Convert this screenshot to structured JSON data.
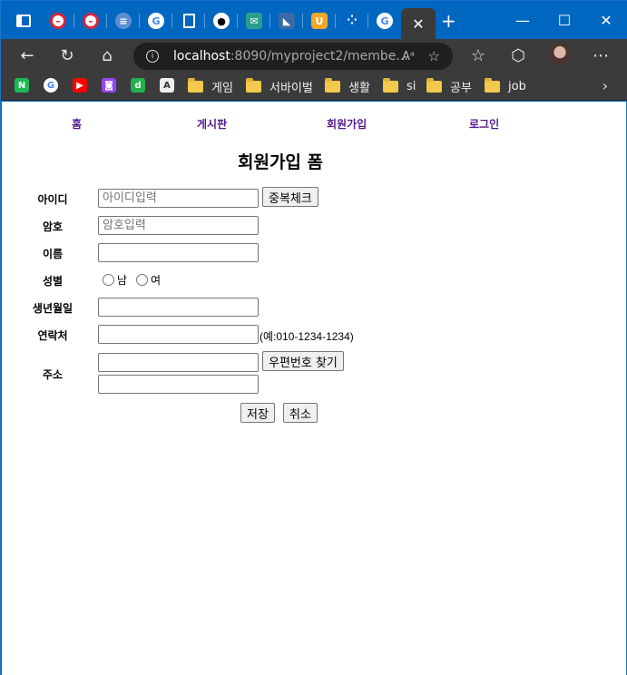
{
  "browser": {
    "url_host": "localhost",
    "url_path": ":8090/myproject2/membe...",
    "read_aloud_label": "Aᵃ",
    "bookmarks": [
      {
        "label": "게임"
      },
      {
        "label": "서바이벌"
      },
      {
        "label": "생활"
      },
      {
        "label": "si"
      },
      {
        "label": "공부"
      },
      {
        "label": "job"
      }
    ]
  },
  "nav": {
    "home": "홈",
    "board": "게시판",
    "signup": "회원가입",
    "login": "로그인"
  },
  "form": {
    "title": "회원가입 폼",
    "id_label": "아이디",
    "id_placeholder": "아이디입력",
    "dup_check_button": "중복체크",
    "pw_label": "암호",
    "pw_placeholder": "암호입력",
    "name_label": "이름",
    "gender_label": "성별",
    "gender_male": "남",
    "gender_female": "여",
    "birth_label": "생년월일",
    "phone_label": "연락처",
    "phone_hint": "(예:010-1234-1234)",
    "address_label": "주소",
    "zip_button": "우편번호 찾기",
    "save_button": "저장",
    "cancel_button": "취소"
  },
  "colors": {
    "titlebar": "#0067c0",
    "toolbar": "#3b3b3b",
    "link": "#551a8b"
  }
}
